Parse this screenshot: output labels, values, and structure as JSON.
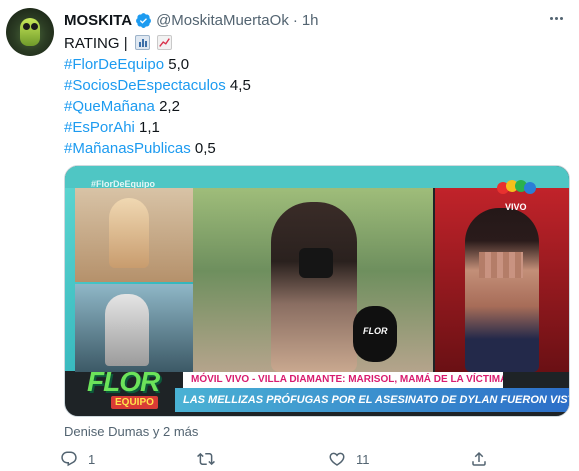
{
  "tweet": {
    "display_name": "MOSKITA",
    "handle": "@MoskitaMuertaOk",
    "separator": "·",
    "time": "1h",
    "lines": [
      {
        "text": "RATING |",
        "emojis": [
          "bar-chart-emoji",
          "chart-increasing-emoji"
        ]
      },
      {
        "hashtag": "#FlorDeEquipo",
        "value": " 5,0"
      },
      {
        "hashtag": "#SociosDeEspectaculos",
        "value": " 4,5"
      },
      {
        "hashtag": "#QueMañana",
        "value": " 2,2"
      },
      {
        "hashtag": "#EsPorAhi",
        "value": " 1,1"
      },
      {
        "hashtag": "#MañanasPublicas",
        "value": " 0,5"
      }
    ],
    "media": {
      "corner_hashtag": "#FlorDeEquipo",
      "channel_label": "VIVO",
      "mic_label": "FLOR",
      "logo_main": "FLOR",
      "logo_sub": "EQUIPO",
      "lower_third_top": "MÓVIL VIVO - VILLA DIAMANTE: MARISOL, MAMÁ DE LA VÍCTIMA",
      "lower_third_bottom": "LAS MELLIZAS PRÓFUGAS POR EL ASESINATO DE DYLAN FUERON VISTAS EN EL BARRIO"
    },
    "tagged": "Denise Dumas y 2 más",
    "actions": {
      "reply_count": "1",
      "retweet_count": "",
      "like_count": "11",
      "share_count": ""
    }
  },
  "colors": {
    "link": "#1d9bf0",
    "secondary_text": "#536471",
    "primary_text": "#0f1419",
    "verified": "#1d9bf0"
  }
}
